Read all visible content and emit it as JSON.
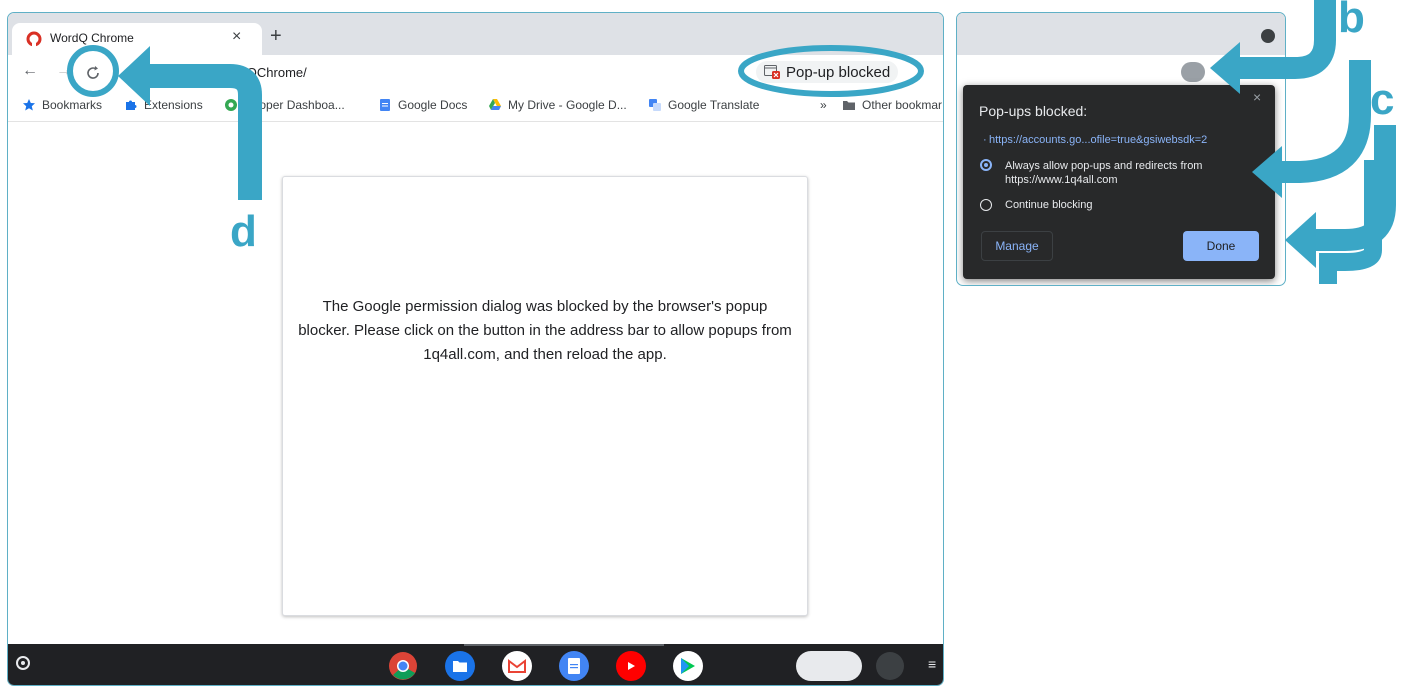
{
  "browser": {
    "tab": {
      "title": "WordQ Chrome",
      "close": "×"
    },
    "new_tab": "+",
    "nav": {
      "back": "←",
      "forward": "→"
    },
    "url": "ordQChrome/",
    "popup_chip": "Pop-up blocked",
    "bookmarks": [
      {
        "label": "Bookmarks",
        "icon": "star-icon"
      },
      {
        "label": "Extensions",
        "icon": "puzzle-icon"
      },
      {
        "label": "veloper Dashboa...",
        "icon": "chrome-webstore-icon"
      },
      {
        "label": "Google Docs",
        "icon": "docs-icon"
      },
      {
        "label": "My Drive - Google D...",
        "icon": "drive-icon"
      },
      {
        "label": "Google Translate",
        "icon": "translate-icon"
      },
      {
        "label": "»",
        "icon": ""
      },
      {
        "label": "Other bookmar",
        "icon": "folder-icon"
      }
    ]
  },
  "content": {
    "message": "The Google permission dialog was blocked by the browser's popup blocker. Please click on the button in the address bar to allow popups from 1q4all.com, and then reload the app."
  },
  "popup_panel": {
    "title": "Pop-ups blocked:",
    "close": "×",
    "link": "https://accounts.go...ofile=true&gsiwebsdk=2",
    "option_allow": "Always allow pop-ups and redirects from https://www.1q4all.com",
    "option_block": "Continue blocking",
    "manage": "Manage",
    "done": "Done"
  },
  "annotations": {
    "b": "b",
    "c": "c",
    "d": "d"
  },
  "colors": {
    "accent": "#3aa6c6",
    "blocked_red": "#d93025",
    "link_blue": "#8ab4f8"
  }
}
